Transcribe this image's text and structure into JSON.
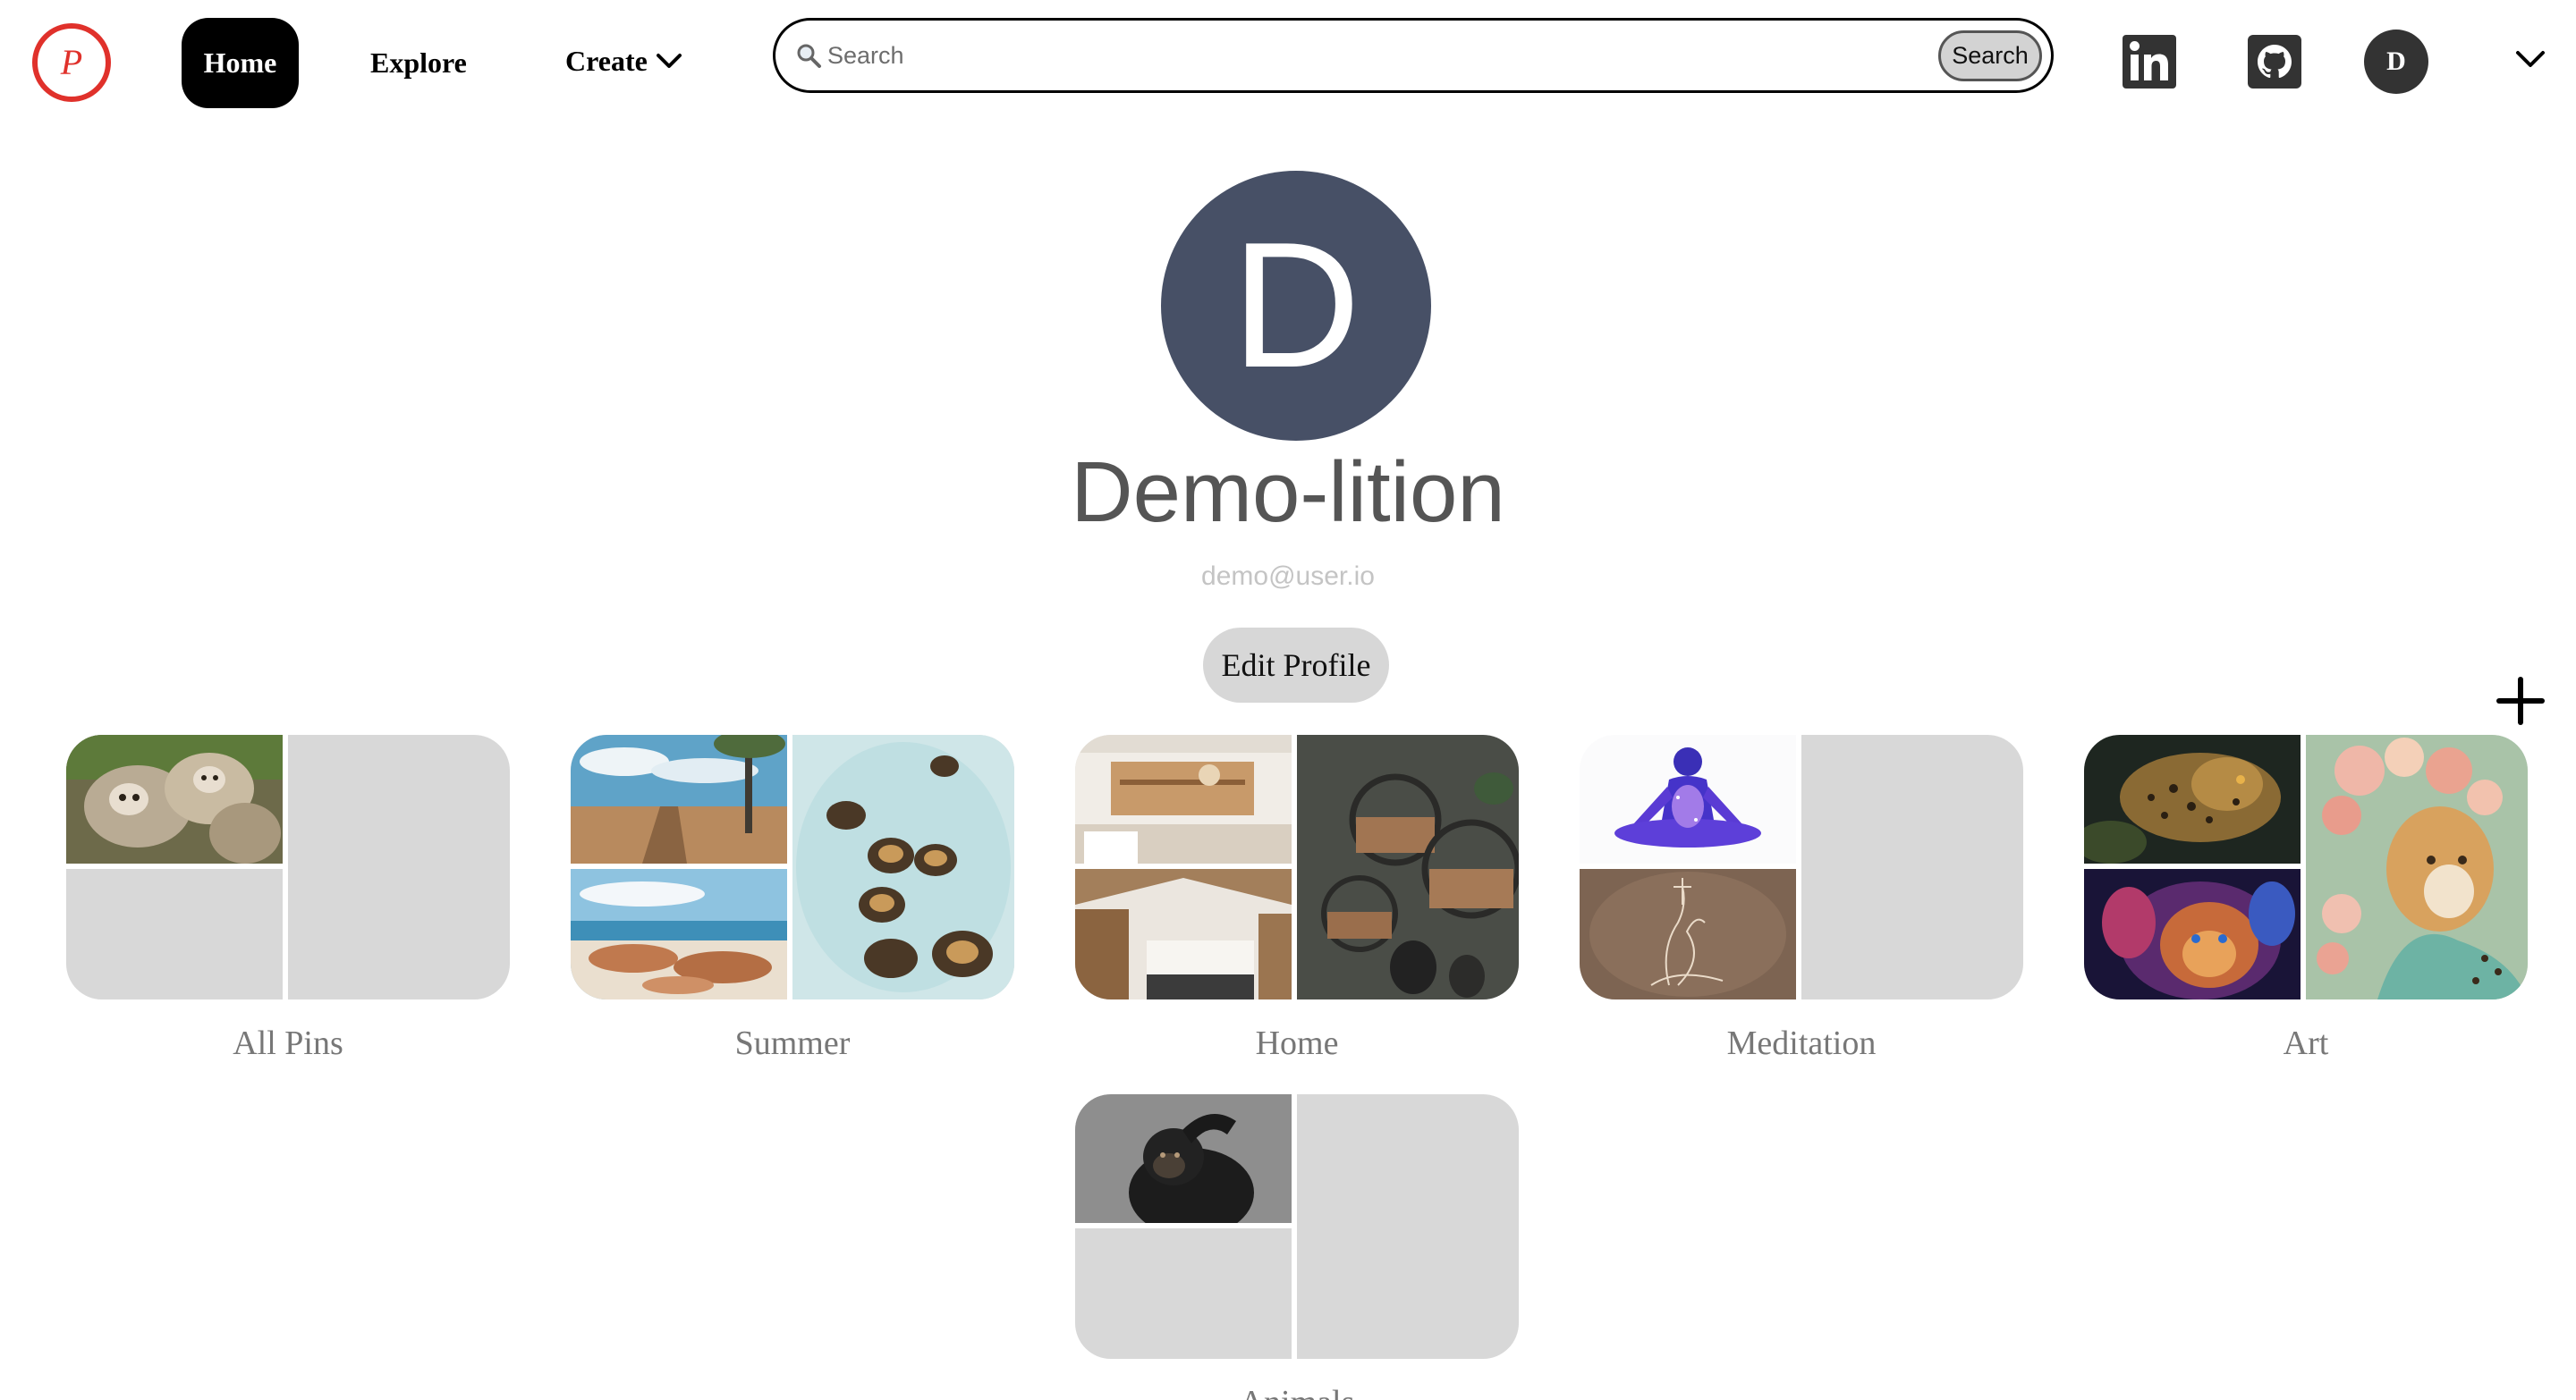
{
  "nav": {
    "logo_text": "P",
    "home_label": "Home",
    "explore_label": "Explore",
    "create_label": "Create",
    "user_initial": "D"
  },
  "search": {
    "placeholder": "Search",
    "button_label": "Search"
  },
  "profile": {
    "initial": "D",
    "name": "Demo-lition",
    "email": "demo@user.io",
    "edit_label": "Edit Profile"
  },
  "boards": [
    {
      "name": "All Pins",
      "images": [
        "sloths",
        "empty",
        "empty"
      ]
    },
    {
      "name": "Summer",
      "images": [
        "beach-boardwalk",
        "beach-rocks",
        "sea-turtles"
      ]
    },
    {
      "name": "Home",
      "images": [
        "interior-shelves",
        "kitchen",
        "round-wall-shelves"
      ]
    },
    {
      "name": "Meditation",
      "images": [
        "cosmic-meditation-figure",
        "sketch-figure",
        "empty"
      ]
    },
    {
      "name": "Art",
      "images": [
        "leopard-art",
        "lion-art",
        "cheetah-flowers"
      ]
    },
    {
      "name": "Animals",
      "images": [
        "chimpanzee",
        "empty",
        "empty"
      ]
    }
  ],
  "colors": {
    "brand": "#e0312b",
    "avatar_bg": "#475066",
    "nav_active_bg": "#000000",
    "placeholder_tile": "#d8d8d8"
  }
}
